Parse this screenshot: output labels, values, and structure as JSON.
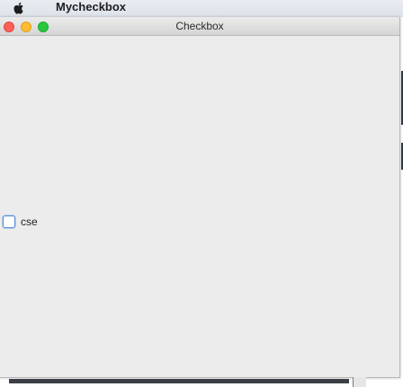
{
  "menubar": {
    "app_name": "Mycheckbox"
  },
  "window": {
    "title": "Checkbox"
  },
  "checkbox": {
    "label": "cse",
    "checked": false
  },
  "colors": {
    "accent": "#5a8fdc",
    "close": "#fd5f57",
    "minimize": "#febc2e",
    "zoom": "#28c840"
  },
  "icons": {
    "apple": "apple-icon"
  }
}
